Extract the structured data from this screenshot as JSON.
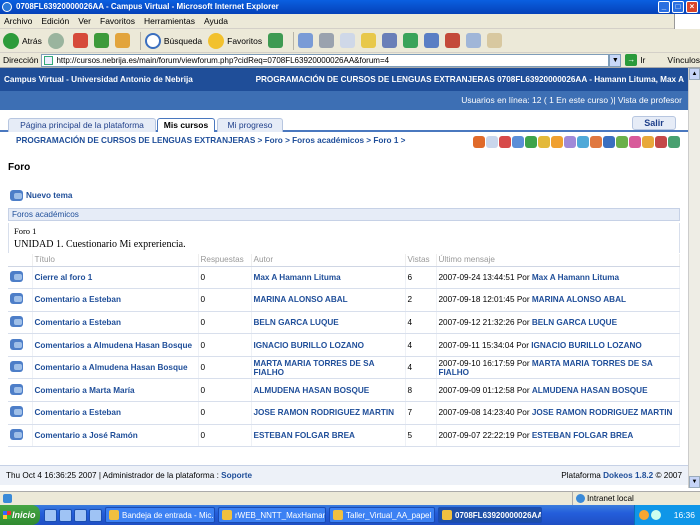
{
  "window": {
    "title": "0708FL63920000026AA - Campus Virtual - Microsoft Internet Explorer"
  },
  "menu": [
    "Archivo",
    "Edición",
    "Ver",
    "Favoritos",
    "Herramientas",
    "Ayuda"
  ],
  "toolbar": {
    "back": "Atrás",
    "search": "Búsqueda",
    "favorites": "Favoritos"
  },
  "address": {
    "label": "Dirección",
    "url": "http://cursos.nebrija.es/main/forum/viewforum.php?cidReq=0708FL63920000026AA&forum=4",
    "go": "Ir",
    "links": "Vínculos"
  },
  "site": {
    "name": "Campus Virtual - Universidad Antonio de Nebrija",
    "course": "PROGRAMACIÓN DE CURSOS DE LENGUAS EXTRANJERAS 0708FL63920000026AA - Hamann Lituma, Max A",
    "online": "Usuarios en línea:  12  ( 1 En este curso  )| Vista de profesor"
  },
  "tabs": {
    "home": "Página principal de la plataforma",
    "courses": "Mis cursos",
    "progress": "Mi progreso",
    "logout": "Salir"
  },
  "breadcrumb": "PROGRAMACIÓN DE CURSOS DE LENGUAS EXTRANJERAS > Foro > Foros académicos > Foro 1 >",
  "page_title": "Foro",
  "new_topic": "Nuevo tema",
  "forum_category": "Foros académicos",
  "forum": {
    "name": "Foro 1",
    "description": "UNIDAD 1. Cuestionario Mi expreriencia."
  },
  "table": {
    "headers": [
      "Título",
      "Respuestas",
      "Autor",
      "Vistas",
      "Último mensaje"
    ],
    "rows": [
      {
        "title": "Cierre al foro 1",
        "replies": "0",
        "author": "Max A Hamann Lituma",
        "views": "6",
        "date": "2007-09-24 13:44:51",
        "by": "Por",
        "last_author": "Max A Hamann Lituma"
      },
      {
        "title": "Comentario a Esteban",
        "replies": "0",
        "author": "MARINA ALONSO ABAL",
        "views": "2",
        "date": "2007-09-18 12:01:45",
        "by": "Por",
        "last_author": "MARINA ALONSO ABAL"
      },
      {
        "title": "Comentario a Esteban",
        "replies": "0",
        "author": "BELN GARCA LUQUE",
        "views": "4",
        "date": "2007-09-12 21:32:26",
        "by": "Por",
        "last_author": "BELN GARCA LUQUE"
      },
      {
        "title": "Comentarios a Almudena Hasan Bosque",
        "replies": "0",
        "author": "IGNACIO BURILLO LOZANO",
        "views": "4",
        "date": "2007-09-11 15:34:04",
        "by": "Por",
        "last_author": "IGNACIO BURILLO LOZANO"
      },
      {
        "title": "Comentario a Almudena Hasan Bosque",
        "replies": "0",
        "author": "MARTA MARIA TORRES DE SA FIALHO",
        "views": "4",
        "date": "2007-09-10 16:17:59",
        "by": "Por",
        "last_author": "MARTA MARIA TORRES DE SA FIALHO"
      },
      {
        "title": "Comentario a Marta María",
        "replies": "0",
        "author": "ALMUDENA HASAN BOSQUE",
        "views": "8",
        "date": "2007-09-09 01:12:58",
        "by": "Por",
        "last_author": "ALMUDENA HASAN BOSQUE"
      },
      {
        "title": "Comentario a Esteban",
        "replies": "0",
        "author": "JOSE RAMON RODRIGUEZ MARTIN",
        "views": "7",
        "date": "2007-09-08 14:23:40",
        "by": "Por",
        "last_author": "JOSE RAMON RODRIGUEZ MARTIN"
      },
      {
        "title": "Comentario a José Ramón",
        "replies": "0",
        "author": "ESTEBAN FOLGAR BREA",
        "views": "5",
        "date": "2007-09-07 22:22:19",
        "by": "Por",
        "last_author": "ESTEBAN FOLGAR BREA"
      }
    ]
  },
  "footer": {
    "left": "Thu Oct 4 16:36:25 2007 | Administrador de la plataforma : ",
    "support": "Soporte",
    "right_pre": "Plataforma ",
    "brand": "Dokeos 1.8.2",
    "right_post": " © 2007"
  },
  "status": {
    "zone": "Intranet local"
  },
  "taskbar": {
    "start": "Inicio",
    "tasks": [
      "Bandeja de entrada - Mic...",
      "rWEB_NNTT_MaxHamann",
      "Taller_Virtual_AA_papel ...",
      "0708FL63920000026AA ..."
    ],
    "clock": "16:36"
  }
}
